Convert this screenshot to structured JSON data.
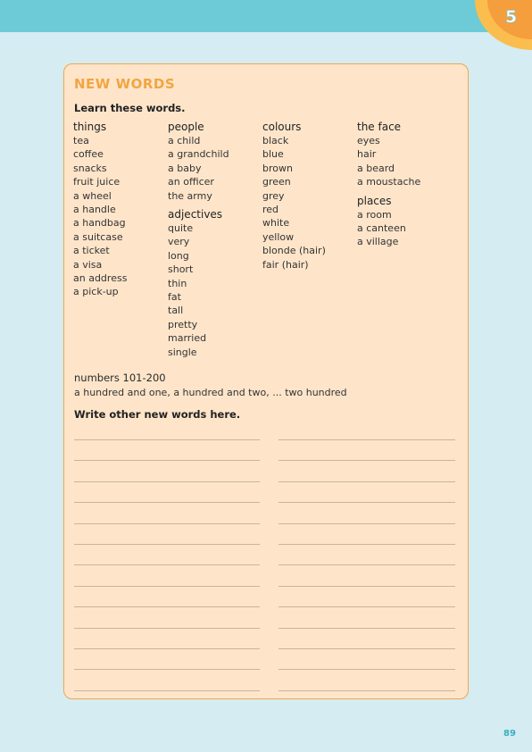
{
  "unit_number": "5",
  "title": "NEW WORDS",
  "instruction": "Learn these words.",
  "columns": [
    {
      "groups": [
        {
          "heading": "things",
          "items": [
            "tea",
            "coffee",
            "snacks",
            "fruit juice",
            "a wheel",
            "a handle",
            "a handbag",
            "a suitcase",
            "a ticket",
            "a visa",
            "an address",
            "a pick-up"
          ]
        }
      ]
    },
    {
      "groups": [
        {
          "heading": "people",
          "items": [
            "a child",
            "a grandchild",
            "a baby",
            "an officer",
            "the army"
          ]
        },
        {
          "heading": "adjectives",
          "items": [
            "quite",
            "very",
            "long",
            "short",
            "thin",
            "fat",
            "tall",
            "pretty",
            "married",
            "single"
          ]
        }
      ]
    },
    {
      "groups": [
        {
          "heading": "colours",
          "items": [
            "black",
            "blue",
            "brown",
            "green",
            "grey",
            "red",
            "white",
            "yellow",
            "blonde (hair)",
            "fair (hair)"
          ]
        }
      ]
    },
    {
      "groups": [
        {
          "heading": "the face",
          "items": [
            "eyes",
            "hair",
            "a beard",
            "a moustache"
          ]
        },
        {
          "heading": "places",
          "items": [
            "a room",
            "a canteen",
            "a village"
          ]
        }
      ]
    }
  ],
  "numbers": {
    "heading": "numbers 101-200",
    "text": "a hundred and one, a hundred and two, ... two hundred"
  },
  "write_prompt": "Write other new words here.",
  "page_number": "89",
  "colors": {
    "band": "#6ccbd6",
    "background": "#d4ecf2",
    "box": "#fee5ca",
    "accent": "#f2a541"
  }
}
